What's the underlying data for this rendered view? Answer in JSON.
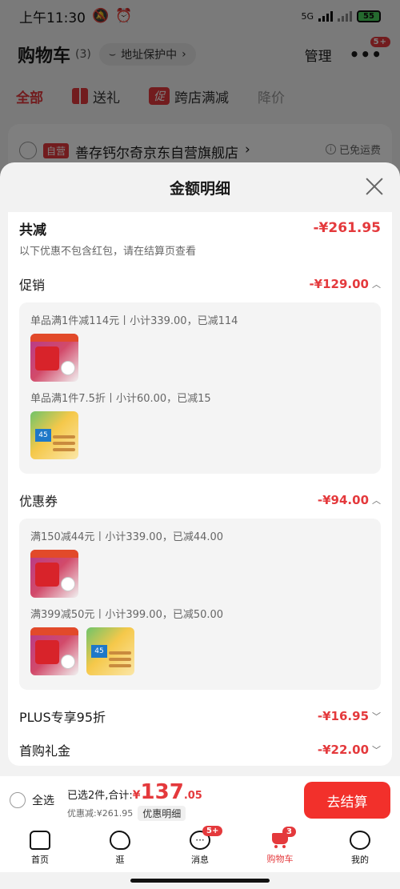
{
  "status_bar": {
    "time": "上午11:30",
    "network": "5G",
    "battery": "55"
  },
  "header": {
    "title": "购物车",
    "count": "(3)",
    "address": "地址保护中",
    "manage": "管理",
    "more_badge": "5+"
  },
  "tabs": [
    {
      "label": "全部"
    },
    {
      "label": "送礼"
    },
    {
      "label": "跨店满减",
      "tag": "促"
    },
    {
      "label": "降价"
    }
  ],
  "store": {
    "tag": "自营",
    "name": "善存钙尔奇京东自营旗舰店",
    "free_shipping": "已免运费"
  },
  "sheet": {
    "title": "金额明细",
    "total_label": "共减",
    "total_value": "-¥261.95",
    "hint": "以下优惠不包含红包，请在结算页查看",
    "promo": {
      "label": "促销",
      "value": "-¥129.00",
      "lines": [
        "单品满1件减114元丨小计339.00，已减114",
        "单品满1件7.5折丨小计60.00，已减15"
      ]
    },
    "coupon": {
      "label": "优惠券",
      "value": "-¥94.00",
      "lines": [
        "满150减44元丨小计339.00，已减44.00",
        "满399减50元丨小计399.00，已减50.00"
      ]
    },
    "plus": {
      "label": "PLUS专享95折",
      "value": "-¥16.95"
    },
    "first": {
      "label": "首购礼金",
      "value": "-¥22.00"
    }
  },
  "checkout": {
    "select_all": "全选",
    "selected": "已选2件,合计:",
    "yen": "¥",
    "price_int": "137",
    "price_dec": ".05",
    "discount": "优惠减:¥261.95",
    "detail": "优惠明细",
    "button": "去结算"
  },
  "tabbar": [
    {
      "label": "首页",
      "icon": "home-icon"
    },
    {
      "label": "逛",
      "icon": "explore-icon"
    },
    {
      "label": "消息",
      "icon": "message-icon",
      "badge": "5+"
    },
    {
      "label": "购物车",
      "icon": "cart-icon",
      "badge": "3"
    },
    {
      "label": "我的",
      "icon": "profile-icon"
    }
  ],
  "colors": {
    "accent": "#e4393c",
    "button": "#f2302b"
  }
}
